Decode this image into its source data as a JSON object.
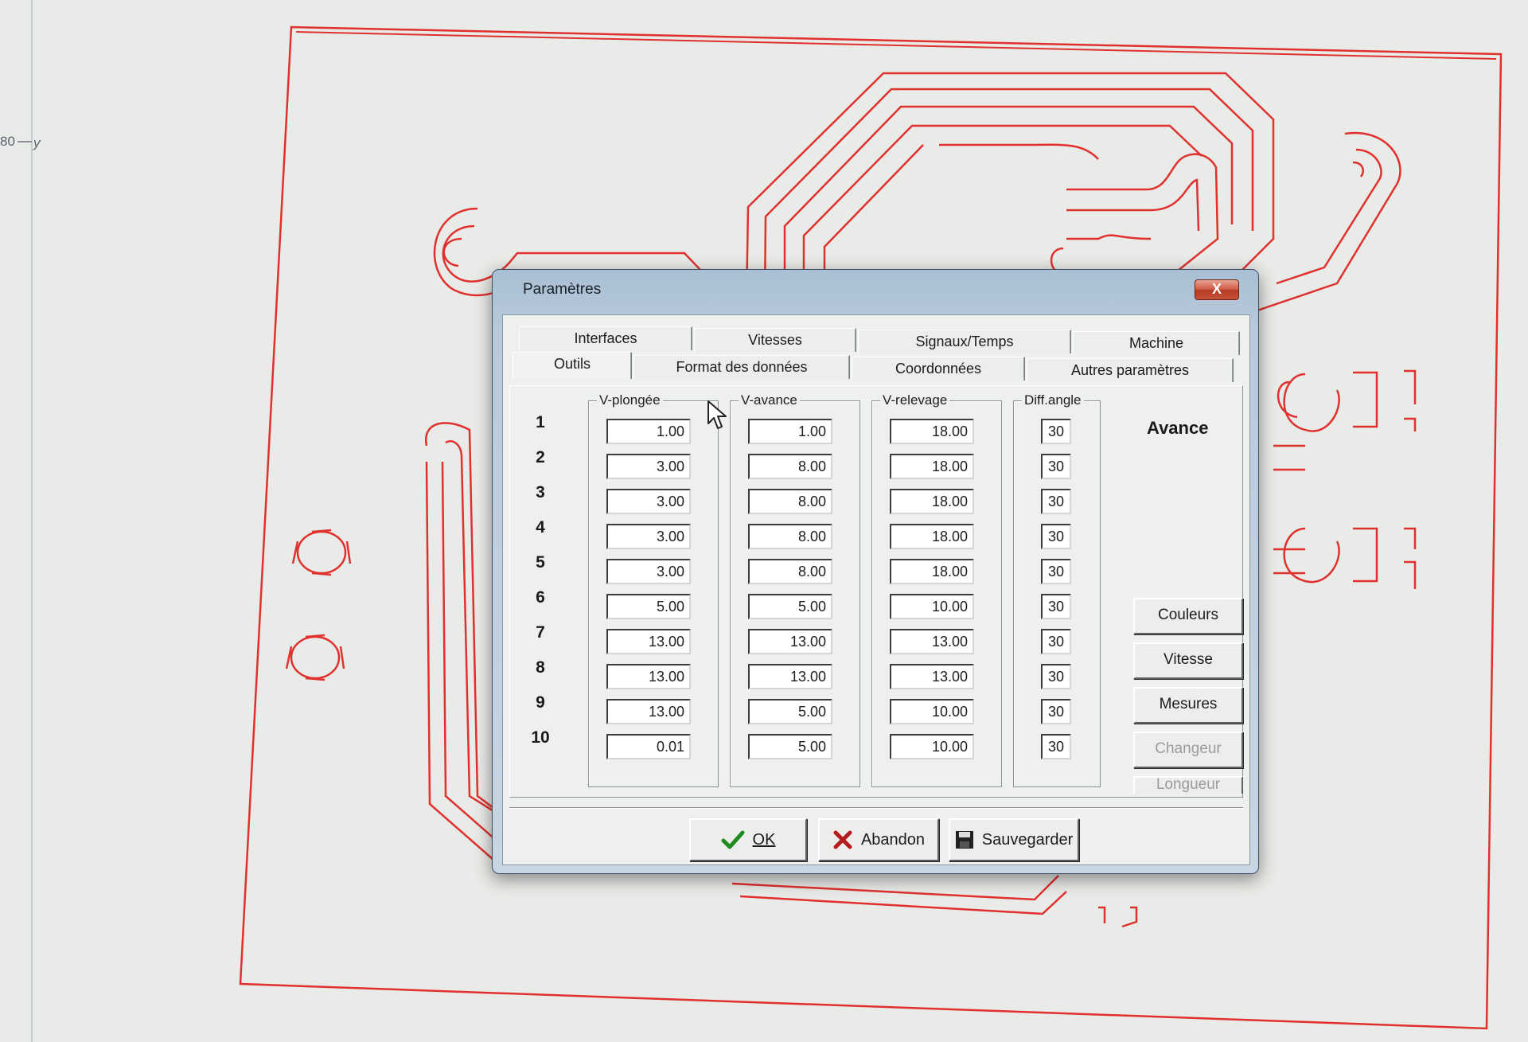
{
  "ruler": {
    "tick_label": "80",
    "axis_label": "y"
  },
  "dialog": {
    "title": "Paramètres",
    "close_label": "X",
    "tabs_row1": [
      "Interfaces",
      "Vitesses",
      "Signaux/Temps",
      "Machine"
    ],
    "tabs_row2": [
      "Outils",
      "Format des données",
      "Coordonnées",
      "Autres paramètres"
    ],
    "active_tab": "Outils",
    "groups": {
      "v_plongee": "V-plongée",
      "v_avance": "V-avance",
      "v_relevage": "V-relevage",
      "diff_angle": "Diff.angle"
    },
    "rows": [
      {
        "num": "1",
        "v_plongee": "1.00",
        "v_avance": "1.00",
        "v_relevage": "18.00",
        "diff_angle": "30"
      },
      {
        "num": "2",
        "v_plongee": "3.00",
        "v_avance": "8.00",
        "v_relevage": "18.00",
        "diff_angle": "30"
      },
      {
        "num": "3",
        "v_plongee": "3.00",
        "v_avance": "8.00",
        "v_relevage": "18.00",
        "diff_angle": "30"
      },
      {
        "num": "4",
        "v_plongee": "3.00",
        "v_avance": "8.00",
        "v_relevage": "18.00",
        "diff_angle": "30"
      },
      {
        "num": "5",
        "v_plongee": "3.00",
        "v_avance": "8.00",
        "v_relevage": "18.00",
        "diff_angle": "30"
      },
      {
        "num": "6",
        "v_plongee": "5.00",
        "v_avance": "5.00",
        "v_relevage": "10.00",
        "diff_angle": "30"
      },
      {
        "num": "7",
        "v_plongee": "13.00",
        "v_avance": "13.00",
        "v_relevage": "13.00",
        "diff_angle": "30"
      },
      {
        "num": "8",
        "v_plongee": "13.00",
        "v_avance": "13.00",
        "v_relevage": "13.00",
        "diff_angle": "30"
      },
      {
        "num": "9",
        "v_plongee": "13.00",
        "v_avance": "5.00",
        "v_relevage": "10.00",
        "diff_angle": "30"
      },
      {
        "num": "10",
        "v_plongee": "0.01",
        "v_avance": "5.00",
        "v_relevage": "10.00",
        "diff_angle": "30"
      }
    ],
    "avance_label": "Avance",
    "side_buttons": [
      {
        "label": "Couleurs",
        "enabled": true
      },
      {
        "label": "Vitesse",
        "enabled": true
      },
      {
        "label": "Mesures",
        "enabled": true
      },
      {
        "label": "Changeur",
        "enabled": false
      },
      {
        "label": "Longueur",
        "enabled": false
      }
    ],
    "ok_label": "OK",
    "abandon_label": "Abandon",
    "save_label": "Sauvegarder",
    "colors": {
      "trace": "#e0312f",
      "title_bar": "#b8cadb",
      "close_button": "#c7543d"
    }
  }
}
